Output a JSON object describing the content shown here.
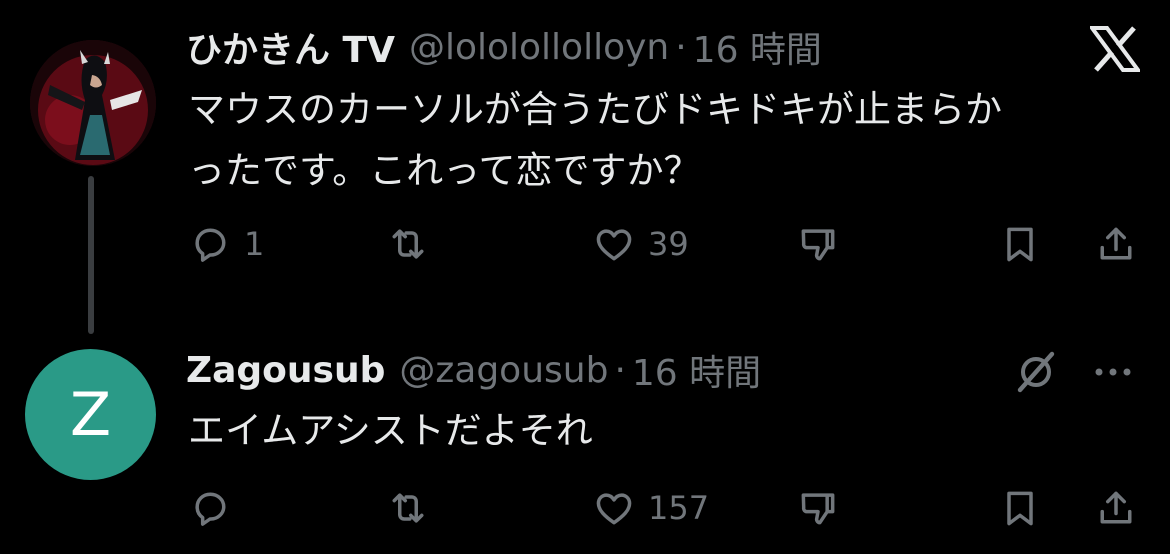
{
  "tweet1": {
    "display_name": "ひかきん TV",
    "handle": "@lololollolloyn",
    "separator": "·",
    "time": "16 時間",
    "text_line1": "マウスのカーソルが合うたびドキドキが止まらか",
    "text_line2": "ったです。これって恋ですか？",
    "reply_count": "1",
    "repost_count": "",
    "like_count": "39",
    "top_icon": "x-logo-icon"
  },
  "tweet2": {
    "avatar_letter": "Z",
    "display_name": "Zagousub",
    "handle": "@zagousub",
    "separator": "·",
    "time": "16 時間",
    "text": "エイムアシストだよそれ",
    "reply_count": "",
    "repost_count": "",
    "like_count": "157",
    "top_icons": [
      "grok-icon",
      "more-icon"
    ]
  },
  "colors": {
    "background": "#000000",
    "text": "#e7e9ea",
    "secondary": "#71767b",
    "avatar2_bg": "#2a9a87"
  }
}
